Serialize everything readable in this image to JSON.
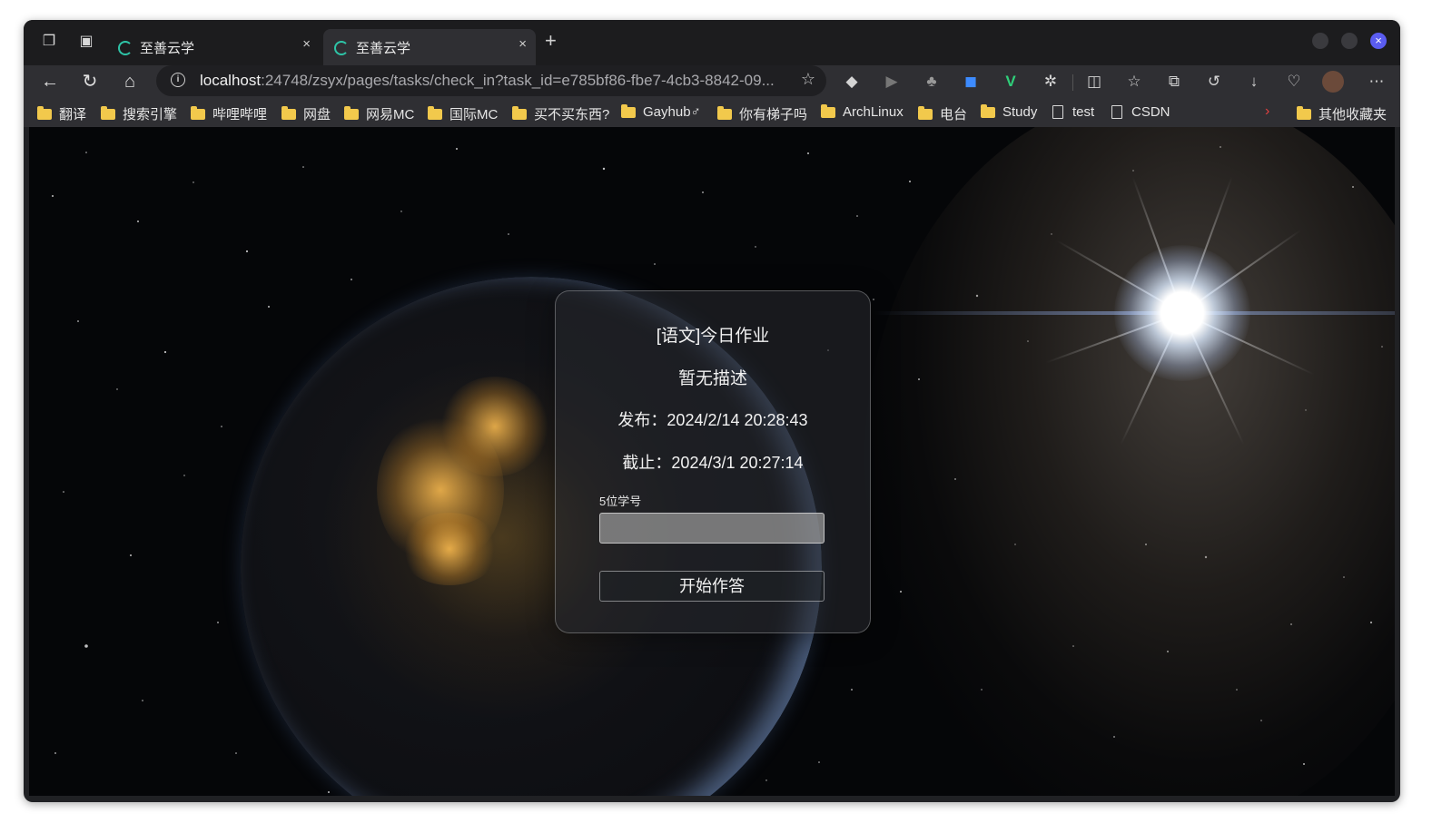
{
  "browser": {
    "tabs": [
      {
        "title": "至善云学",
        "active": false
      },
      {
        "title": "至善云学",
        "active": true
      }
    ],
    "address_bar": {
      "host": "localhost",
      "rest": ":24748/zsyx/pages/tasks/check_in?task_id=e785bf86-fbe7-4cb3-8842-09..."
    },
    "bookmarks": [
      {
        "label": "翻译",
        "type": "folder"
      },
      {
        "label": "搜索引擎",
        "type": "folder"
      },
      {
        "label": "哔哩哔哩",
        "type": "folder"
      },
      {
        "label": "网盘",
        "type": "folder"
      },
      {
        "label": "网易MC",
        "type": "folder"
      },
      {
        "label": "国际MC",
        "type": "folder"
      },
      {
        "label": "买不买东西?",
        "type": "folder"
      },
      {
        "label": "Gayhub♂",
        "type": "folder"
      },
      {
        "label": "你有梯子吗",
        "type": "folder"
      },
      {
        "label": "ArchLinux",
        "type": "folder"
      },
      {
        "label": "电台",
        "type": "folder"
      },
      {
        "label": "Study",
        "type": "folder"
      },
      {
        "label": "test",
        "type": "page"
      },
      {
        "label": "CSDN",
        "type": "page"
      }
    ],
    "other_bookmarks": "其他收藏夹",
    "icons": {
      "workspaces": "❐",
      "tab_actions": "▣",
      "back": "←",
      "reload": "↻",
      "home": "⌂",
      "new_tab": "+",
      "close": "×",
      "star": "☆",
      "more": "⋯"
    }
  },
  "card": {
    "title": "[语文]今日作业",
    "description": "暂无描述",
    "published": "发布：2024/2/14 20:28:43",
    "deadline": "截止：2024/3/1 20:27:14",
    "field_label": "5位学号",
    "field_value": "",
    "button_label": "开始作答"
  },
  "colors": {
    "folder": "#f2c94c",
    "favicon": "#2ec4a7",
    "window_close": "#5a5cf0"
  }
}
